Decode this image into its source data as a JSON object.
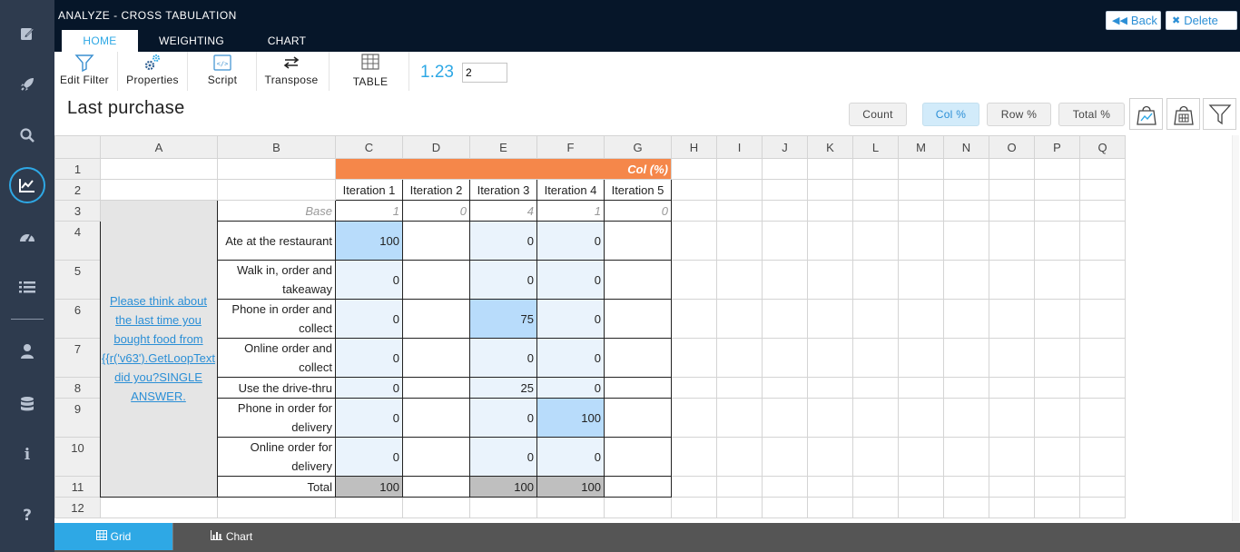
{
  "app": {
    "title": "ANALYZE - CROSS TABULATION"
  },
  "header": {
    "back_label": "Back",
    "delete_label": "Delete"
  },
  "tabs": [
    {
      "label": "HOME",
      "active": true
    },
    {
      "label": "WEIGHTING",
      "active": false
    },
    {
      "label": "CHART",
      "active": false
    }
  ],
  "toolbar": {
    "edit_filter": "Edit Filter",
    "properties": "Properties",
    "script": "Script",
    "transpose": "Transpose",
    "table": "TABLE",
    "decimals_label": "1.23",
    "decimals_value": "2"
  },
  "report": {
    "title": "Last purchase"
  },
  "percent_buttons": {
    "count": "Count",
    "col": "Col %",
    "row": "Row %",
    "total": "Total %",
    "active": "Col %"
  },
  "grid": {
    "columns": [
      "A",
      "B",
      "C",
      "D",
      "E",
      "F",
      "G",
      "H",
      "I",
      "J",
      "K",
      "L",
      "M",
      "N",
      "O",
      "P",
      "Q"
    ],
    "rows": [
      "1",
      "2",
      "3",
      "4",
      "5",
      "6",
      "7",
      "8",
      "9",
      "10",
      "11",
      "12"
    ],
    "banner": "Col (%)",
    "iterations": [
      "Iteration 1",
      "Iteration 2",
      "Iteration 3",
      "Iteration 4",
      "Iteration 5"
    ],
    "base_label": "Base",
    "base": [
      "1",
      "0",
      "4",
      "1",
      "0"
    ],
    "question": "Please think about the last time you bought food from {{r('v63').GetLoopText did you?SINGLE ANSWER.",
    "answers": [
      {
        "label": "Ate at the restaurant",
        "values": [
          "100",
          "",
          "0",
          "0",
          ""
        ]
      },
      {
        "label": "Walk in, order and takeaway",
        "values": [
          "0",
          "",
          "0",
          "0",
          ""
        ]
      },
      {
        "label": "Phone in order and collect",
        "values": [
          "0",
          "",
          "75",
          "0",
          ""
        ]
      },
      {
        "label": "Online order and collect",
        "values": [
          "0",
          "",
          "0",
          "0",
          ""
        ]
      },
      {
        "label": "Use the drive-thru",
        "values": [
          "0",
          "",
          "25",
          "0",
          ""
        ]
      },
      {
        "label": "Phone in order for delivery",
        "values": [
          "0",
          "",
          "0",
          "100",
          ""
        ]
      },
      {
        "label": "Online order for delivery",
        "values": [
          "0",
          "",
          "0",
          "0",
          ""
        ]
      }
    ],
    "total": {
      "label": "Total",
      "values": [
        "100",
        "",
        "100",
        "100",
        ""
      ]
    }
  },
  "bottom_tabs": {
    "grid": "Grid",
    "chart": "Chart"
  },
  "colors": {
    "accent": "#2ea8e5",
    "banner": "#f5874a",
    "sidebar": "#2e3b4e",
    "header": "#061629"
  }
}
